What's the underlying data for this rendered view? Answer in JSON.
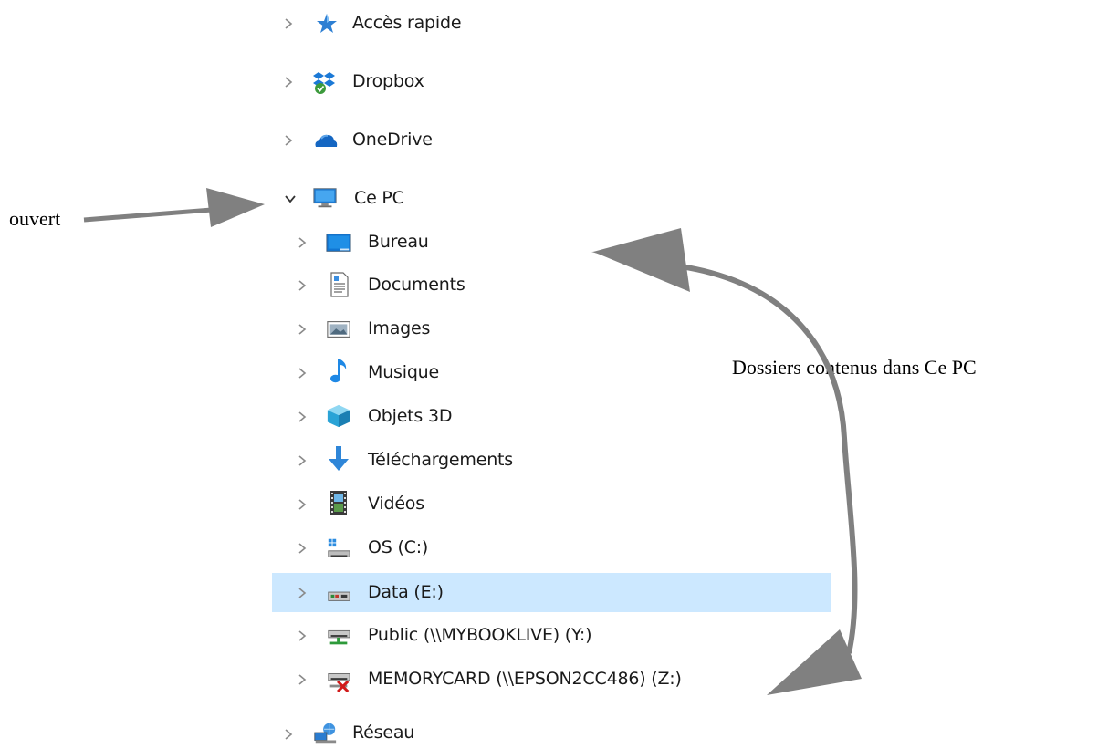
{
  "nav": {
    "quick_access": "Accès rapide",
    "dropbox": "Dropbox",
    "onedrive": "OneDrive",
    "this_pc": "Ce PC",
    "children": [
      {
        "label": "Bureau",
        "icon": "desktop-folder-icon"
      },
      {
        "label": "Documents",
        "icon": "documents-folder-icon"
      },
      {
        "label": "Images",
        "icon": "pictures-folder-icon"
      },
      {
        "label": "Musique",
        "icon": "music-note-icon"
      },
      {
        "label": "Objets 3D",
        "icon": "cube-3d-icon"
      },
      {
        "label": "Téléchargements",
        "icon": "download-arrow-icon"
      },
      {
        "label": "Vidéos",
        "icon": "film-strip-icon"
      },
      {
        "label": "OS (C:)",
        "icon": "windows-drive-icon"
      },
      {
        "label": "Data (E:)",
        "icon": "local-drive-icon",
        "selected": true
      },
      {
        "label": "Public (\\\\MYBOOKLIVE) (Y:)",
        "icon": "network-drive-icon"
      },
      {
        "label": "MEMORYCARD (\\\\EPSON2CC486) (Z:)",
        "icon": "disconnected-network-drive-icon"
      }
    ],
    "network": "Réseau"
  },
  "annotations": {
    "opened": "ouvert",
    "folders_in_pc": "Dossiers contenus dans Ce PC"
  },
  "colors": {
    "selection": "#cce8ff",
    "arrow": "#808080",
    "chevron": "#8a8a8a"
  }
}
